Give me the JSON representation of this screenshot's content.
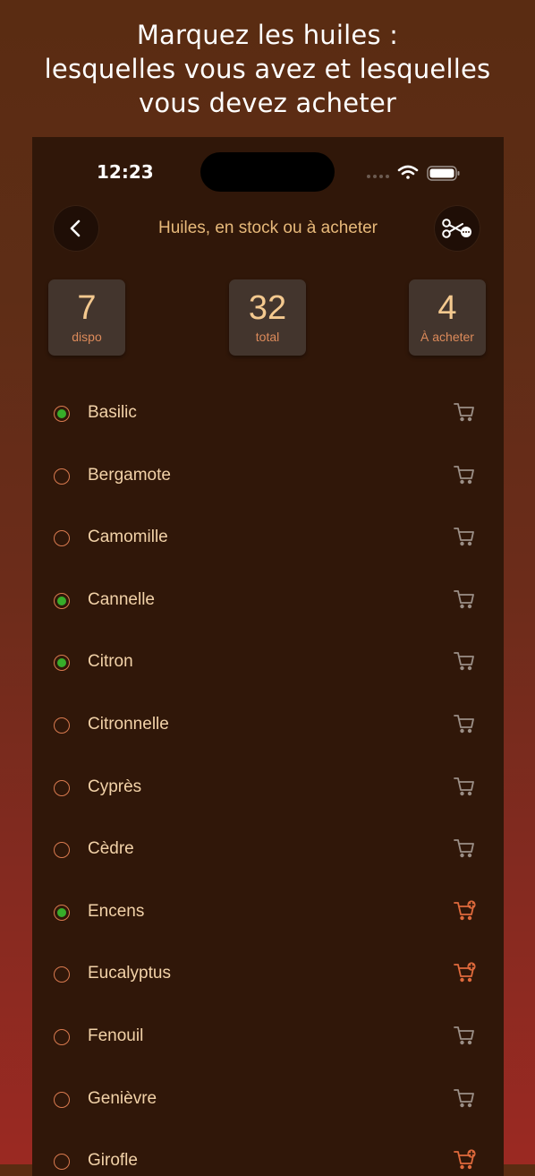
{
  "headline": {
    "line1": "Marquez les huiles :",
    "line2": "lesquelles vous avez et lesquelles",
    "line3": "vous devez acheter"
  },
  "status_bar": {
    "time": "12:23"
  },
  "nav": {
    "title": "Huiles, en stock ou à acheter",
    "back_icon": "chevron-left-icon",
    "right_icon": "scissors-more-icon"
  },
  "stats": [
    {
      "value": "7",
      "label": "dispo"
    },
    {
      "value": "32",
      "label": "total"
    },
    {
      "value": "4",
      "label": "À acheter"
    }
  ],
  "colors": {
    "accent": "#e7b97a",
    "checked": "#37ad2a",
    "to_buy": "#e06a3c",
    "cart_idle": "#9b8f87"
  },
  "oils": [
    {
      "name": "Basilic",
      "owned": true,
      "to_buy": false
    },
    {
      "name": "Bergamote",
      "owned": false,
      "to_buy": false
    },
    {
      "name": "Camomille",
      "owned": false,
      "to_buy": false
    },
    {
      "name": "Cannelle",
      "owned": true,
      "to_buy": false
    },
    {
      "name": "Citron",
      "owned": true,
      "to_buy": false
    },
    {
      "name": "Citronnelle",
      "owned": false,
      "to_buy": false
    },
    {
      "name": "Cyprès",
      "owned": false,
      "to_buy": false
    },
    {
      "name": "Cèdre",
      "owned": false,
      "to_buy": false
    },
    {
      "name": "Encens",
      "owned": true,
      "to_buy": true
    },
    {
      "name": "Eucalyptus",
      "owned": false,
      "to_buy": true
    },
    {
      "name": "Fenouil",
      "owned": false,
      "to_buy": false
    },
    {
      "name": "Genièvre",
      "owned": false,
      "to_buy": false
    },
    {
      "name": "Girofle",
      "owned": false,
      "to_buy": true
    }
  ]
}
